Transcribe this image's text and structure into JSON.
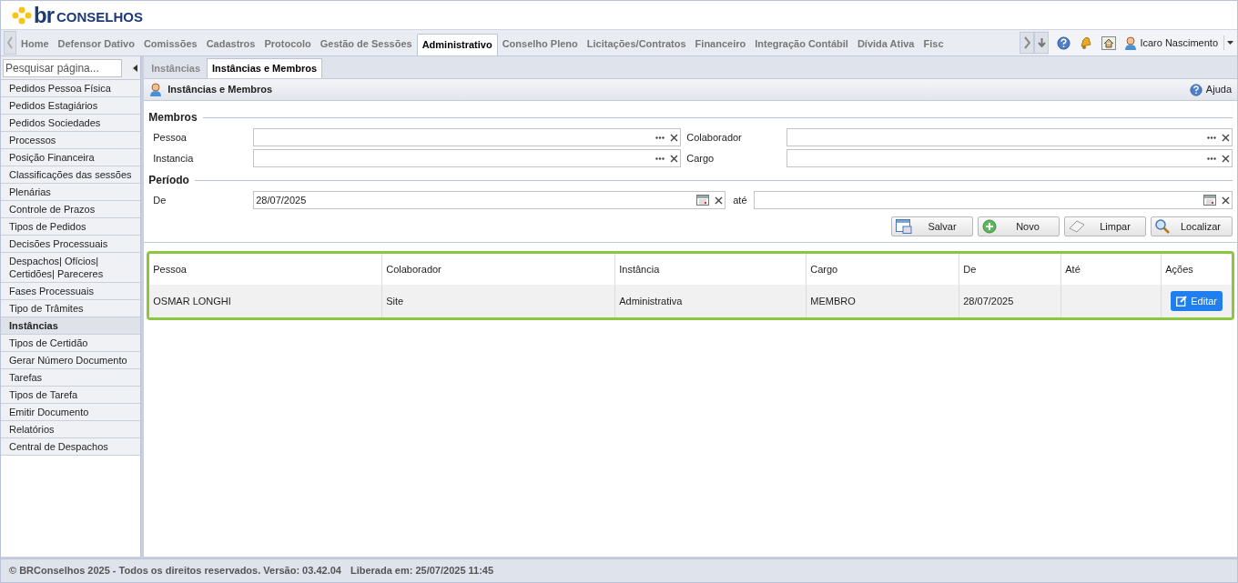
{
  "logo": {
    "brand": "br",
    "name": "CONSELHOS"
  },
  "nav_tabs": [
    {
      "label": "Home",
      "selected": false
    },
    {
      "label": "Defensor Dativo",
      "selected": false
    },
    {
      "label": "Comissões",
      "selected": false
    },
    {
      "label": "Cadastros",
      "selected": false
    },
    {
      "label": "Protocolo",
      "selected": false
    },
    {
      "label": "Gestão de Sessões",
      "selected": false
    },
    {
      "label": "Administrativo",
      "selected": true
    },
    {
      "label": "Conselho Pleno",
      "selected": false
    },
    {
      "label": "Licitações/Contratos",
      "selected": false
    },
    {
      "label": "Financeiro",
      "selected": false
    },
    {
      "label": "Integração Contábil",
      "selected": false
    },
    {
      "label": "Dívida Ativa",
      "selected": false
    },
    {
      "label": "Fisc",
      "selected": false
    }
  ],
  "user": {
    "name": "Icaro Nascimento"
  },
  "sidebar": {
    "search_placeholder": "Pesquisar página...",
    "items": [
      {
        "label": "Pedidos Pessoa Física",
        "selected": false
      },
      {
        "label": "Pedidos Estagiários",
        "selected": false
      },
      {
        "label": "Pedidos Sociedades",
        "selected": false
      },
      {
        "label": "Processos",
        "selected": false
      },
      {
        "label": "Posição Financeira",
        "selected": false
      },
      {
        "label": "Classificações das sessões",
        "selected": false
      },
      {
        "label": "Plenárias",
        "selected": false
      },
      {
        "label": "Controle de Prazos",
        "selected": false
      },
      {
        "label": "Tipos de Pedidos",
        "selected": false
      },
      {
        "label": "Decisões Processuais",
        "selected": false
      },
      {
        "label": "Despachos| Ofícios| Certidões| Pareceres",
        "selected": false
      },
      {
        "label": "Fases Processuais",
        "selected": false
      },
      {
        "label": "Tipo de Trâmites",
        "selected": false
      },
      {
        "label": "Instâncias",
        "selected": true
      },
      {
        "label": "Tipos de Certidão",
        "selected": false
      },
      {
        "label": "Gerar Número Documento",
        "selected": false
      },
      {
        "label": "Tarefas",
        "selected": false
      },
      {
        "label": "Tipos de Tarefa",
        "selected": false
      },
      {
        "label": "Emitir Documento",
        "selected": false
      },
      {
        "label": "Relatórios",
        "selected": false
      },
      {
        "label": "Central de Despachos",
        "selected": false
      }
    ]
  },
  "sub_tabs": [
    {
      "label": "Instâncias",
      "selected": false
    },
    {
      "label": "Instâncias e Membros",
      "selected": true
    }
  ],
  "panel": {
    "title": "Instâncias e Membros",
    "help": "Ajuda"
  },
  "membros": {
    "legend": "Membros",
    "fields": [
      {
        "label": "Pessoa"
      },
      {
        "label": "Colaborador"
      },
      {
        "label": "Instancia"
      },
      {
        "label": "Cargo"
      }
    ]
  },
  "periodo": {
    "legend": "Período",
    "from_label": "De",
    "from_value": "28/07/2025",
    "to_label": "até"
  },
  "buttons": [
    {
      "kind": "save",
      "label": "Salvar"
    },
    {
      "kind": "new",
      "label": "Novo"
    },
    {
      "kind": "clear",
      "label": "Limpar"
    },
    {
      "kind": "find",
      "label": "Localizar"
    }
  ],
  "table": {
    "columns": [
      "Pessoa",
      "Colaborador",
      "Instância",
      "Cargo",
      "De",
      "Até",
      "Ações"
    ],
    "rows": [
      {
        "cells": [
          "OSMAR LONGHI",
          "Site",
          "Administrativa",
          "MEMBRO",
          "28/07/2025",
          ""
        ],
        "action": "Editar"
      }
    ]
  },
  "status_bar": {
    "text": "© BRConselhos 2025 - Todos os direitos reservados. Versão: 03.42.04",
    "released": "Liberada em: 25/07/2025 11:45"
  }
}
